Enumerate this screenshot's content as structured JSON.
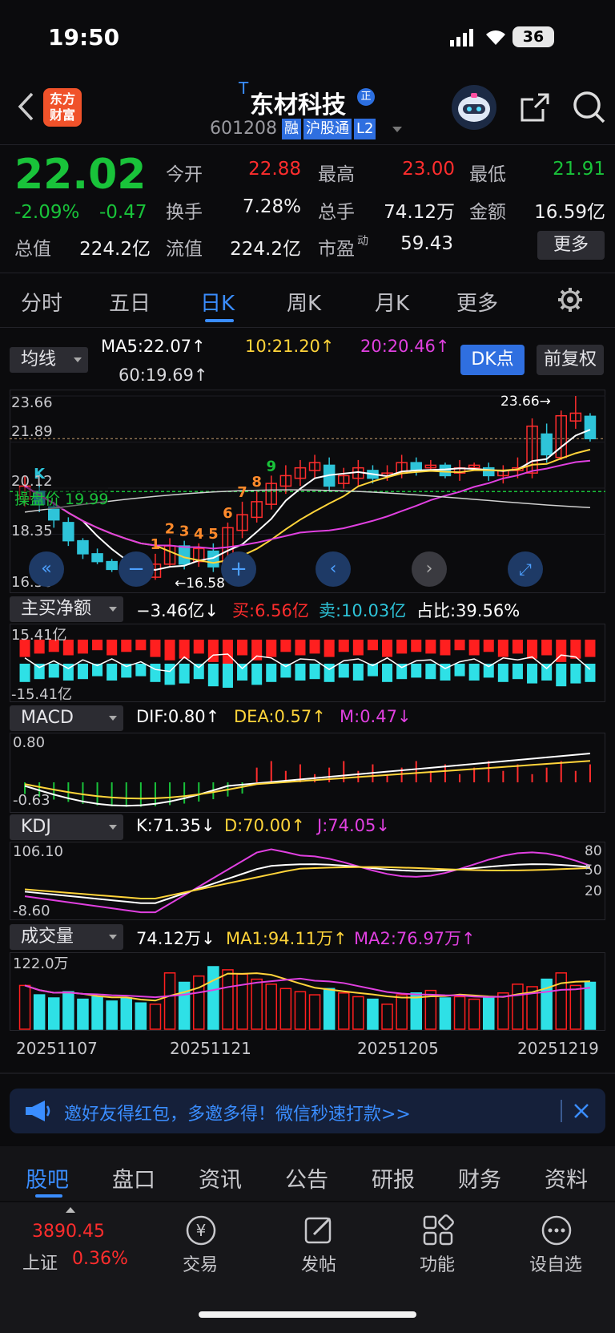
{
  "status": {
    "time": "19:50",
    "battery": "36"
  },
  "header": {
    "logo": "东方\n财富",
    "title_prefix": "T",
    "title": "东材科技",
    "badge": "正",
    "code": "601208",
    "tags": [
      "融",
      "沪股通",
      "L2"
    ]
  },
  "quote": {
    "price": "22.02",
    "change_pct": "-2.09%",
    "change": "-0.47",
    "fields": [
      {
        "label": "今开",
        "value": "22.88",
        "color": "up"
      },
      {
        "label": "最高",
        "value": "23.00",
        "color": "up"
      },
      {
        "label": "最低",
        "value": "21.91",
        "color": "down"
      },
      {
        "label": "换手",
        "value": "7.28%",
        "color": "white"
      },
      {
        "label": "总手",
        "value": "74.12万",
        "color": "white"
      },
      {
        "label": "金额",
        "value": "16.59亿",
        "color": "white"
      },
      {
        "label": "总值",
        "value": "224.2亿",
        "color": "white"
      },
      {
        "label": "流值",
        "value": "224.2亿",
        "color": "white"
      },
      {
        "label": "市盈",
        "value": "59.43",
        "color": "white"
      }
    ],
    "pe_sup": "动",
    "more": "更多"
  },
  "tabs": [
    "分时",
    "五日",
    "日K",
    "周K",
    "月K",
    "更多"
  ],
  "active_tab": "日K",
  "ma": {
    "selector": "均线",
    "ma5": "MA5:22.07",
    "ma10": "10:21.20",
    "ma20": "20:20.46",
    "ma60": "60:19.69",
    "dk": "DK点",
    "fq": "前复权",
    "arrow": "↑"
  },
  "kline": {
    "labels": [
      "23.66",
      "21.89",
      "20.12",
      "18.35",
      "16.58"
    ],
    "high": "23.66→",
    "low": "←16.58",
    "break": "操盘价 19.99",
    "candles": [
      {
        "o": 19.7,
        "c": 20.2,
        "h": 20.6,
        "l": 19.4
      },
      {
        "o": 20.0,
        "c": 19.5,
        "h": 20.3,
        "l": 19.2
      },
      {
        "o": 19.4,
        "c": 18.9,
        "h": 19.6,
        "l": 18.6
      },
      {
        "o": 18.8,
        "c": 18.1,
        "h": 19.0,
        "l": 17.9
      },
      {
        "o": 18.1,
        "c": 17.6,
        "h": 18.2,
        "l": 17.4
      },
      {
        "o": 17.6,
        "c": 17.3,
        "h": 17.8,
        "l": 17.2
      },
      {
        "o": 17.3,
        "c": 17.0,
        "h": 17.4,
        "l": 16.9
      },
      {
        "o": 17.0,
        "c": 16.8,
        "h": 17.2,
        "l": 16.7
      },
      {
        "o": 16.8,
        "c": 16.6,
        "h": 17.1,
        "l": 16.58
      },
      {
        "o": 16.7,
        "c": 17.2,
        "h": 17.6,
        "l": 16.6
      },
      {
        "o": 17.2,
        "c": 17.9,
        "h": 18.2,
        "l": 17.1
      },
      {
        "o": 17.9,
        "c": 17.2,
        "h": 18.1,
        "l": 17.0
      },
      {
        "o": 17.3,
        "c": 17.8,
        "h": 18.0,
        "l": 17.1
      },
      {
        "o": 17.7,
        "c": 17.1,
        "h": 18.0,
        "l": 16.9
      },
      {
        "o": 17.2,
        "c": 18.6,
        "h": 18.8,
        "l": 17.1
      },
      {
        "o": 18.5,
        "c": 19.1,
        "h": 19.6,
        "l": 18.2
      },
      {
        "o": 19.0,
        "c": 19.6,
        "h": 20.0,
        "l": 18.8
      },
      {
        "o": 19.5,
        "c": 20.3,
        "h": 20.6,
        "l": 19.3
      },
      {
        "o": 20.2,
        "c": 20.6,
        "h": 21.0,
        "l": 19.9
      },
      {
        "o": 20.5,
        "c": 20.9,
        "h": 21.2,
        "l": 20.2
      },
      {
        "o": 20.8,
        "c": 21.1,
        "h": 21.4,
        "l": 20.5
      },
      {
        "o": 21.0,
        "c": 20.2,
        "h": 21.3,
        "l": 20.0
      },
      {
        "o": 20.3,
        "c": 20.6,
        "h": 20.9,
        "l": 20.1
      },
      {
        "o": 20.5,
        "c": 20.9,
        "h": 21.2,
        "l": 20.2
      },
      {
        "o": 20.8,
        "c": 20.5,
        "h": 21.0,
        "l": 20.3
      },
      {
        "o": 20.6,
        "c": 20.7,
        "h": 21.0,
        "l": 20.4
      },
      {
        "o": 20.7,
        "c": 21.1,
        "h": 21.4,
        "l": 20.5
      },
      {
        "o": 21.1,
        "c": 20.8,
        "h": 21.3,
        "l": 20.6
      },
      {
        "o": 20.9,
        "c": 21.0,
        "h": 21.2,
        "l": 20.8
      },
      {
        "o": 21.0,
        "c": 20.6,
        "h": 21.1,
        "l": 20.5
      },
      {
        "o": 20.7,
        "c": 20.9,
        "h": 21.2,
        "l": 20.4
      },
      {
        "o": 20.9,
        "c": 21.0,
        "h": 21.1,
        "l": 20.8
      },
      {
        "o": 20.9,
        "c": 20.6,
        "h": 21.1,
        "l": 20.4
      },
      {
        "o": 20.6,
        "c": 20.8,
        "h": 21.0,
        "l": 20.3
      },
      {
        "o": 20.8,
        "c": 20.9,
        "h": 21.3,
        "l": 20.5
      },
      {
        "o": 20.7,
        "c": 22.5,
        "h": 22.8,
        "l": 20.5
      },
      {
        "o": 22.2,
        "c": 21.4,
        "h": 22.6,
        "l": 21.1
      },
      {
        "o": 21.3,
        "c": 22.9,
        "h": 23.1,
        "l": 21.2
      },
      {
        "o": 22.7,
        "c": 23.0,
        "h": 23.66,
        "l": 22.4
      },
      {
        "o": 22.88,
        "c": 22.02,
        "h": 23.0,
        "l": 21.91
      }
    ],
    "marks": [
      {
        "i": 1,
        "t": "K",
        "c": "#2ec4d9"
      },
      {
        "i": 9,
        "t": "1",
        "c": "#ff8a2b"
      },
      {
        "i": 10,
        "t": "2",
        "c": "#ff8a2b"
      },
      {
        "i": 11,
        "t": "3",
        "c": "#ff8a2b"
      },
      {
        "i": 12,
        "t": "4",
        "c": "#ff8a2b"
      },
      {
        "i": 13,
        "t": "5",
        "c": "#ff8a2b"
      },
      {
        "i": 14,
        "t": "6",
        "c": "#ff8a2b"
      },
      {
        "i": 15,
        "t": "7",
        "c": "#ff8a2b"
      },
      {
        "i": 16,
        "t": "8",
        "c": "#ff8a2b"
      },
      {
        "i": 17,
        "t": "9",
        "c": "#19c33a"
      }
    ]
  },
  "net": {
    "selector": "主买净额",
    "value": "−3.46亿↓",
    "buy": "买:6.56亿",
    "sell": "卖:10.03亿",
    "ratio": "占比:39.56%",
    "top": "15.41亿",
    "bottom": "-15.41亿"
  },
  "macd": {
    "selector": "MACD",
    "dif": "DIF:0.80↑",
    "dea": "DEA:0.57↑",
    "m": "M:0.47↓",
    "top": "0.80",
    "bottom": "-0.63"
  },
  "kdj": {
    "selector": "KDJ",
    "k": "K:71.35↓",
    "d": "D:70.00↑",
    "j": "J:74.05↓",
    "top": "106.10",
    "bottom": "-8.60",
    "r80": "80",
    "r50": "50",
    "r20": "20"
  },
  "vol": {
    "selector": "成交量",
    "value": "74.12万↓",
    "ma1": "MA1:94.11万↑",
    "ma2": "MA2:76.97万↑",
    "top": "122.0万"
  },
  "dates": [
    "20251107",
    "20251121",
    "20251205",
    "20251219"
  ],
  "banner": {
    "text": "邀好友得红包，多邀多得！微信秒速打款>>"
  },
  "bottom_tabs": [
    "股吧",
    "盘口",
    "资讯",
    "公告",
    "研报",
    "财务",
    "资料"
  ],
  "index": {
    "value": "3890.45",
    "name": "上证",
    "pct": "0.36%"
  },
  "actions": [
    "交易",
    "发帖",
    "功能",
    "设自选"
  ]
}
